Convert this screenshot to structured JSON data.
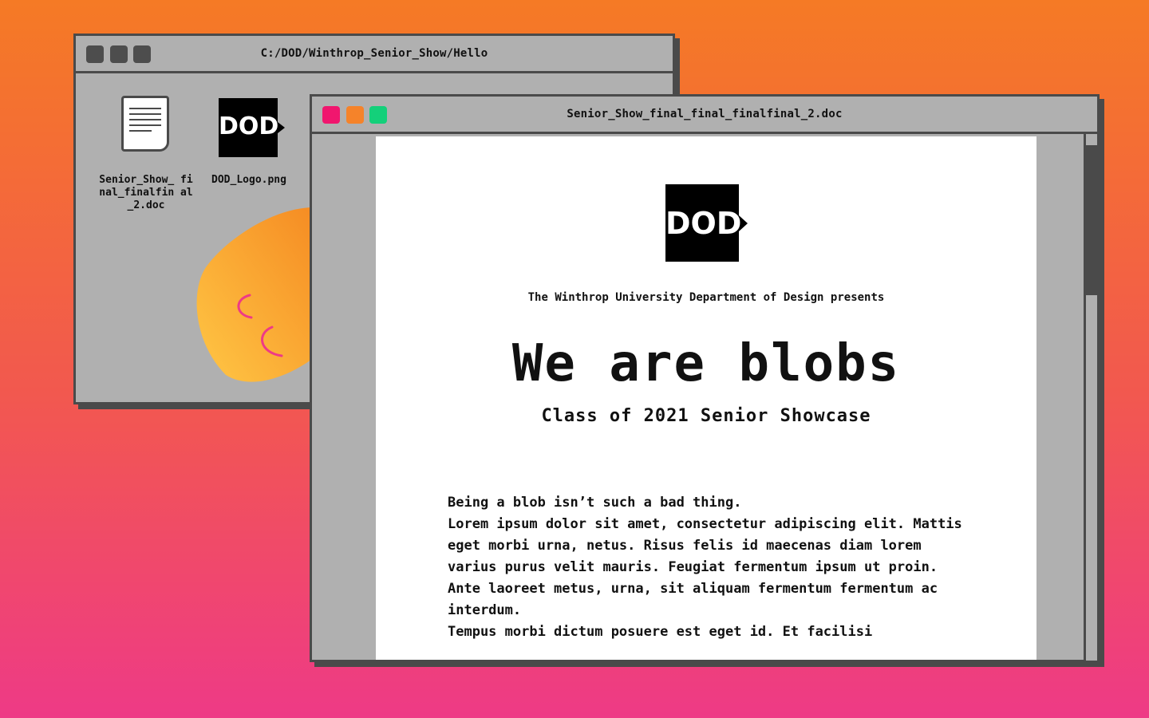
{
  "colors": {
    "background_top": "#f57a25",
    "background_bottom": "#ee3a86",
    "window_gray": "#b0b0b0",
    "border": "#4a4a4a",
    "traffic_red": "#f0166e",
    "traffic_orange": "#f5832a",
    "traffic_green": "#14d07a",
    "blob_orange": "#f7a233",
    "blob_accent": "#ee3a86"
  },
  "back_window": {
    "title": "C:/DOD/Winthrop_Senior_Show/Hello",
    "files": [
      {
        "icon": "document-icon",
        "label": "Senior_Show_ final_finalfin al_2.doc"
      },
      {
        "icon": "dod-logo-image-icon",
        "label": "DOD_Logo.png",
        "logo_text": "DOD"
      }
    ]
  },
  "front_window": {
    "title": "Senior_Show_final_final_finalfinal_2.doc",
    "document": {
      "logo_text": "DOD",
      "presents": "The Winthrop University Department of Design presents",
      "headline": "We are blobs",
      "subhead": "Class of 2021 Senior Showcase",
      "paragraphs": [
        "Being a blob isn’t such a bad thing.",
        "Lorem ipsum dolor sit amet, consectetur adipiscing elit. Mattis eget morbi urna, netus. Risus felis id maecenas diam lorem varius purus velit mauris. Feugiat fermentum ipsum ut proin. Ante laoreet metus, urna, sit aliquam fermentum fermentum ac interdum.",
        "Tempus morbi dictum posuere est eget id. Et facilisi"
      ]
    }
  }
}
